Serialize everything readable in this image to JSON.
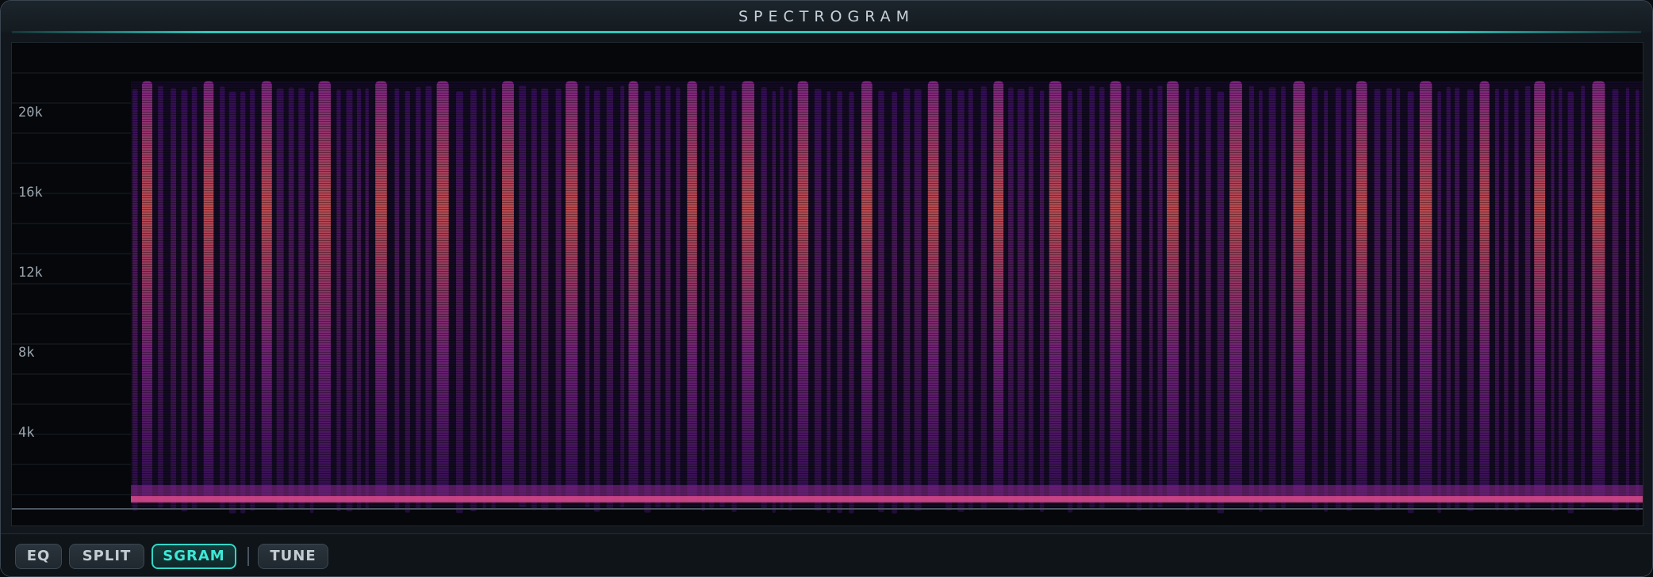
{
  "window": {
    "title": "SPECTROGRAM"
  },
  "colors": {
    "accent": "#2ec8be",
    "active_text": "#3ce8d6",
    "spectrum_low": "#3b0f63",
    "spectrum_mid": "#8a2a8e",
    "spectrum_high": "#e05a5a"
  },
  "spectrogram": {
    "frequency_ticks": [
      "20k",
      "16k",
      "12k",
      "8k",
      "4k"
    ]
  },
  "toolbar": {
    "buttons": [
      {
        "label": "EQ",
        "active": false
      },
      {
        "label": "SPLIT",
        "active": false
      },
      {
        "label": "SGRAM",
        "active": true
      },
      {
        "label": "TUNE",
        "active": false
      }
    ]
  }
}
